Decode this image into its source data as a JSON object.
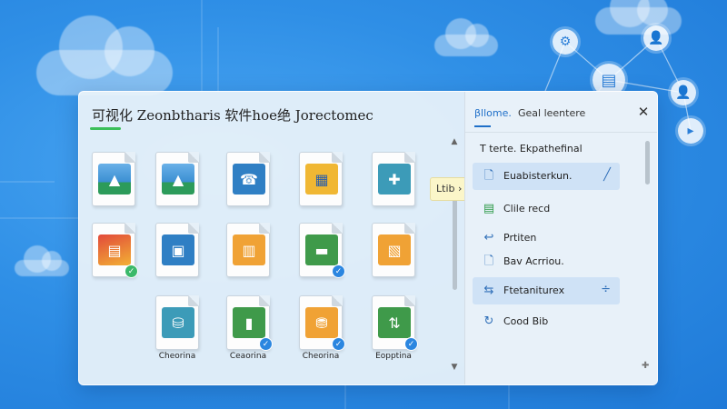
{
  "window": {
    "title": "可视化 Zeonbtharis 软件hoe绝 Jorectomec"
  },
  "files": [
    {
      "art": "art-mtn",
      "icon": "▲",
      "badge": "",
      "label": ""
    },
    {
      "art": "art-mtn",
      "icon": "▲",
      "badge": "",
      "label": ""
    },
    {
      "art": "art-blue",
      "icon": "☎",
      "badge": "",
      "label": ""
    },
    {
      "art": "art-yellow",
      "icon": "▦",
      "badge": "",
      "label": ""
    },
    {
      "art": "art-teal",
      "icon": "✚",
      "badge": "",
      "label": ""
    },
    {
      "art": "art-red",
      "icon": "▤",
      "badge": "green",
      "label": ""
    },
    {
      "art": "art-blue",
      "icon": "▣",
      "badge": "",
      "label": ""
    },
    {
      "art": "art-orange",
      "icon": "▥",
      "badge": "",
      "label": ""
    },
    {
      "art": "art-green",
      "icon": "▬",
      "badge": "blue",
      "label": ""
    },
    {
      "art": "art-orange",
      "icon": "▧",
      "badge": "",
      "label": ""
    },
    {
      "art": "art-teal",
      "icon": "⛁",
      "badge": "",
      "label": "Cheorina"
    },
    {
      "art": "art-green",
      "icon": "▮",
      "badge": "blue",
      "label": "Ceaorina"
    },
    {
      "art": "art-orange",
      "icon": "⛃",
      "badge": "blue",
      "label": "Cheorina"
    },
    {
      "art": "art-green",
      "icon": "⇅",
      "badge": "blue",
      "label": "Eopptina"
    }
  ],
  "tooltip": "Ltib ›",
  "panel": {
    "tab_active": "βllome.",
    "tab_other": "Geal leentere",
    "close_icon": "✕",
    "heading": "T terte. Ekpathefinal",
    "items": [
      {
        "icon": "🗋",
        "label": "Euabisterkun.",
        "trail": "╱",
        "selected": true
      },
      {
        "icon": "▤",
        "label": "Clile recd",
        "trail": "",
        "selected": false
      },
      {
        "icon": "↩",
        "label": "Prtiten",
        "trail": "",
        "selected": false
      },
      {
        "icon": "🗋",
        "label": "Bav Acrriou.",
        "trail": "",
        "selected": false
      },
      {
        "icon": "⇆",
        "label": "Ftetaniturex",
        "trail": "÷",
        "selected": true
      },
      {
        "icon": "↻",
        "label": "Cood Bib",
        "trail": "",
        "selected": false
      }
    ]
  }
}
